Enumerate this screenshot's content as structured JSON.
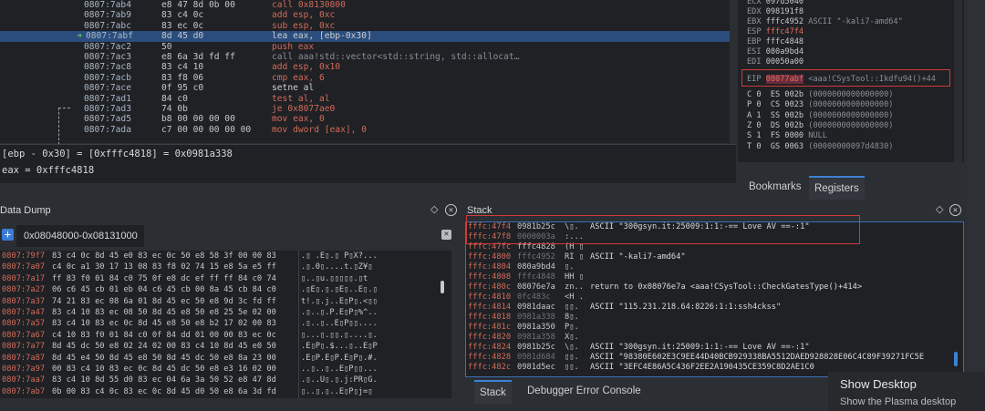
{
  "disasm": {
    "rows": [
      {
        "addr": "0807:7ab4",
        "bytes": "e8 47 8d 0b 00",
        "ins": "call 0x8130800",
        "style": "red"
      },
      {
        "addr": "0807:7ab9",
        "bytes": "83 c4 0c",
        "ins": "add esp, 0xc",
        "style": "red"
      },
      {
        "addr": "0807:7abc",
        "bytes": "83 ec 0c",
        "ins": "sub esp, 0xc",
        "style": "red"
      },
      {
        "addr": "0807:7abf",
        "bytes": "8d 45 d0",
        "ins": "lea eax, [ebp-0x30]",
        "style": "sel"
      },
      {
        "addr": "0807:7ac2",
        "bytes": "50",
        "ins": "push eax",
        "style": "red"
      },
      {
        "addr": "0807:7ac3",
        "bytes": "e8 6a 3d fd ff",
        "ins": "call aaa!std::vector<std::string, std::allocat…",
        "style": "gray"
      },
      {
        "addr": "0807:7ac8",
        "bytes": "83 c4 10",
        "ins": "add esp, 0x10",
        "style": "red"
      },
      {
        "addr": "0807:7acb",
        "bytes": "83 f8 06",
        "ins": "cmp eax, 6",
        "style": "red"
      },
      {
        "addr": "0807:7ace",
        "bytes": "0f 95 c0",
        "ins": "setne al",
        "style": "normal"
      },
      {
        "addr": "0807:7ad1",
        "bytes": "84 c0",
        "ins": "test al, al",
        "style": "red"
      },
      {
        "addr": "0807:7ad3",
        "bytes": "74 0b",
        "ins": "je 0x8077ae0",
        "style": "red"
      },
      {
        "addr": "0807:7ad5",
        "bytes": "b8 00 00 00 00",
        "ins": "mov eax, 0",
        "style": "red"
      },
      {
        "addr": "0807:7ada",
        "bytes": "c7 00 00 00 00 00",
        "ins": "mov dword [eax], 0",
        "style": "red"
      }
    ]
  },
  "info": {
    "line1": "[ebp - 0x30] = [0xfffc4818] = 0x0981a338",
    "line2": "eax = 0xfffc4818"
  },
  "registers": {
    "rows": [
      {
        "name": "ECX",
        "val": "097d5040",
        "cmt": "",
        "red": false
      },
      {
        "name": "EDX",
        "val": "098191f8",
        "cmt": "",
        "red": false
      },
      {
        "name": "EBX",
        "val": "fffc4952",
        "cmt": "ASCII \"-kali7-amd64\"",
        "red": false
      },
      {
        "name": "ESP",
        "val": "fffc47f4",
        "cmt": "",
        "red": true
      },
      {
        "name": "EBP",
        "val": "fffc4848",
        "cmt": "",
        "red": false
      },
      {
        "name": "ESI",
        "val": "080a9bd4",
        "cmt": "",
        "red": false
      },
      {
        "name": "EDI",
        "val": "00050a00",
        "cmt": "",
        "red": false
      }
    ],
    "eip": {
      "name": "EIP",
      "val": "08077abf",
      "cmt": "<aaa!CSysTool::Ikdfu94()+44"
    },
    "flags": [
      {
        "f": "C 0",
        "seg": "ES 002b",
        "cmt": "(0000000000000000)"
      },
      {
        "f": "P 0",
        "seg": "CS 0023",
        "cmt": "(0000000000000000)"
      },
      {
        "f": "A 1",
        "seg": "SS 002b",
        "cmt": "(0000000000000000)"
      },
      {
        "f": "Z 0",
        "seg": "DS 002b",
        "cmt": "(0000000000000000)"
      },
      {
        "f": "S 1",
        "seg": "FS 0000",
        "cmt": "NULL"
      },
      {
        "f": "T 0",
        "seg": "GS 0063",
        "cmt": "(00000000097d4830)"
      }
    ]
  },
  "right_tabs": {
    "bookmarks": "Bookmarks",
    "registers": "Registers"
  },
  "dump": {
    "title": "Data Dump",
    "tab_label": "0x08048000-0x08131000",
    "rows": [
      {
        "addr": "0807:79f7",
        "hex": "83 c4 0c 8d 45 e0 83 ec 0c 50 e8 58 3f 00 00 83",
        "asc": ".▯ .E▯.▯ P▯X?..."
      },
      {
        "addr": "0807:7a07",
        "hex": "c4 0c a1 30 17 13 08 83 f8 02 74 15 e8 5a e5 ff",
        "asc": ".▯.0▯....t.▯Z¥▯"
      },
      {
        "addr": "0807:7a17",
        "hex": "ff 83 f0 01 84 c0 75 0f e8 dc ef ff ff 84 c0 74",
        "asc": "▯..▯u.▯▯▯▯▯.▯t"
      },
      {
        "addr": "0807:7a27",
        "hex": "06 c6 45 cb 01 eb 04 c6 45 cb 00 8a 45 cb 84 c0",
        "asc": ".▯E▯.▯.▯E▯..E▯.▯"
      },
      {
        "addr": "0807:7a37",
        "hex": "74 21 83 ec 08 6a 01 8d 45 ec 50 e8 9d 3c fd ff",
        "asc": "t!.▯.j..E▯P▯.<▯▯"
      },
      {
        "addr": "0807:7a47",
        "hex": "83 c4 10 83 ec 08 50 8d 45 e8 50 e8 25 5e 02 00",
        "asc": ".▯..▯.P.E▯P▯%^.."
      },
      {
        "addr": "0807:7a57",
        "hex": "83 c4 10 83 ec 0c 8d 45 e8 50 e8 b2 17 02 00 83",
        "asc": ".▯..▯..E▯P▯▯...."
      },
      {
        "addr": "0807:7a67",
        "hex": "c4 10 83 f0 01 84 c0 0f 84 dd 01 00 00 83 ec 0c",
        "asc": "▯...▯.▯▯.▯....▯."
      },
      {
        "addr": "0807:7a77",
        "hex": "8d 45 dc 50 e8 02 24 02 00 83 c4 10 8d 45 e0 50",
        "asc": ".E▯P▯.$...▯..E▯P"
      },
      {
        "addr": "0807:7a87",
        "hex": "8d 45 e4 50 8d 45 e8 50 8d 45 dc 50 e8 8a 23 00",
        "asc": ".E▯P.E▯P.E▯P▯.#."
      },
      {
        "addr": "0807:7a97",
        "hex": "00 83 c4 10 83 ec 0c 8d 45 dc 50 e8 e3 16 02 00",
        "asc": "..▯..▯..E▯P▯▯..."
      },
      {
        "addr": "0807:7aa7",
        "hex": "83 c4 10 8d 55 d0 83 ec 04 6a 3a 50 52 e8 47 8d",
        "asc": ".▯..U▯.▯.j:PR▯G."
      },
      {
        "addr": "0807:7ab7",
        "hex": "0b 00 83 c4 0c 83 ec 0c 8d 45 d0 50 e8 6a 3d fd",
        "asc": "▯..▯.▯..E▯P▯j=▯"
      }
    ]
  },
  "stack": {
    "title": "Stack",
    "rows": [
      {
        "addr": "fffc:47f4",
        "val": "0981b25c",
        "asc": "\\▯.",
        "cmt": "ASCII \"300gsyn.it:25009:1:1:-== Love AV ==-:1\"",
        "dim": false
      },
      {
        "addr": "fffc:47f8",
        "val": "0000003a",
        "asc": ":...",
        "cmt": "",
        "dim": true
      },
      {
        "addr": "fffc:47fc",
        "val": "fffc4828",
        "asc": "(H ▯",
        "cmt": "",
        "dim": false
      },
      {
        "addr": "fffc:4800",
        "val": "fffc4952",
        "asc": "RI ▯",
        "cmt": "ASCII \"-kali7-amd64\"",
        "dim": true
      },
      {
        "addr": "fffc:4804",
        "val": "080a9bd4",
        "asc": "▯.",
        "cmt": "",
        "dim": false
      },
      {
        "addr": "fffc:4808",
        "val": "fffc4848",
        "asc": "HH ▯",
        "cmt": "",
        "dim": true
      },
      {
        "addr": "fffc:480c",
        "val": "08076e7a",
        "asc": "zn..",
        "cmt": "return to 0x08076e7a <aaa!CSysTool::CheckGatesType()+414>",
        "dim": false
      },
      {
        "addr": "fffc:4810",
        "val": "0fc483c",
        "asc": "<H .",
        "cmt": "",
        "dim": true
      },
      {
        "addr": "fffc:4814",
        "val": "0981daac",
        "asc": "▯▯.",
        "cmt": "ASCII \"115.231.218.64:8226:1:1:ssh4ckss\"",
        "dim": false
      },
      {
        "addr": "fffc:4818",
        "val": "0981a338",
        "asc": "8▯.",
        "cmt": "",
        "dim": true
      },
      {
        "addr": "fffc:481c",
        "val": "0981a350",
        "asc": "P▯.",
        "cmt": "",
        "dim": false
      },
      {
        "addr": "fffc:4820",
        "val": "0981a358",
        "asc": "X▯.",
        "cmt": "",
        "dim": true
      },
      {
        "addr": "fffc:4824",
        "val": "0981b25c",
        "asc": "\\▯.",
        "cmt": "ASCII \"300gsyn.it:25009:1:1:-== Love AV ==-:1\"",
        "dim": false
      },
      {
        "addr": "fffc:4828",
        "val": "0981d684",
        "asc": "▯▯.",
        "cmt": "ASCII \"98380E602E3C9EE44D40BCB929338BA5512DAED928828E06C4C89F39271FC5E",
        "dim": true
      },
      {
        "addr": "fffc:482c",
        "val": "0981d5ec",
        "asc": "▯▯.",
        "cmt": "ASCII \"3EFC4E86A5C436F2EE2A190435CE359C8D2AE1C0",
        "dim": false
      }
    ]
  },
  "bottom_tabs": {
    "stack": "Stack",
    "error_console": "Debugger Error Console"
  },
  "tooltip": {
    "title": "Show Desktop",
    "subtitle": "Show the Plasma desktop"
  },
  "colors": {
    "selection": "#2a4d7e",
    "highlight_box": "#d03a3a",
    "address_red": "#d26b5a"
  }
}
